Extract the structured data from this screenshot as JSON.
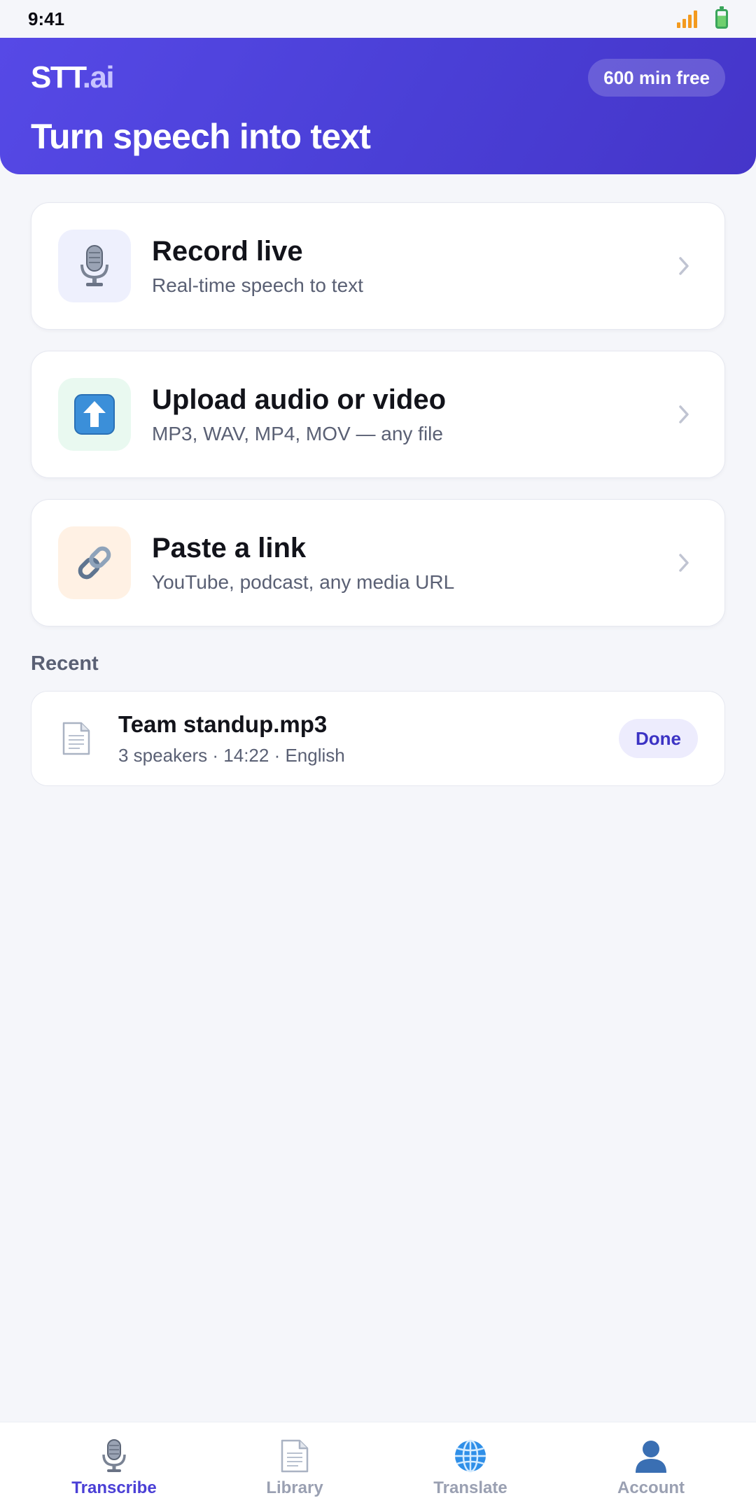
{
  "status_bar": {
    "time": "9:41"
  },
  "header": {
    "brand_main": "STT",
    "brand_suffix": ".ai",
    "free_badge": "600 min free",
    "hero_title": "Turn speech into text"
  },
  "actions": [
    {
      "title": "Record live",
      "subtitle": "Real-time speech to text",
      "icon": "microphone-icon",
      "icon_bg": "#eef0fd"
    },
    {
      "title": "Upload audio or video",
      "subtitle": "MP3, WAV, MP4, MOV — any file",
      "icon": "upload-arrow-icon",
      "icon_bg": "#e9f9f0"
    },
    {
      "title": "Paste a link",
      "subtitle": "YouTube, podcast, any media URL",
      "icon": "link-icon",
      "icon_bg": "#fff1e4"
    }
  ],
  "recent": {
    "label": "Recent",
    "items": [
      {
        "title": "Team standup.mp3",
        "meta": "3 speakers · 14:22 · English",
        "status": "Done"
      }
    ]
  },
  "nav": [
    {
      "label": "Transcribe",
      "icon": "microphone-icon",
      "active": true
    },
    {
      "label": "Library",
      "icon": "document-icon",
      "active": false
    },
    {
      "label": "Translate",
      "icon": "globe-icon",
      "active": false
    },
    {
      "label": "Account",
      "icon": "user-icon",
      "active": false
    }
  ],
  "colors": {
    "accent": "#4a3fd6",
    "background": "#f5f6fa",
    "done_badge_bg": "#edecfd"
  }
}
